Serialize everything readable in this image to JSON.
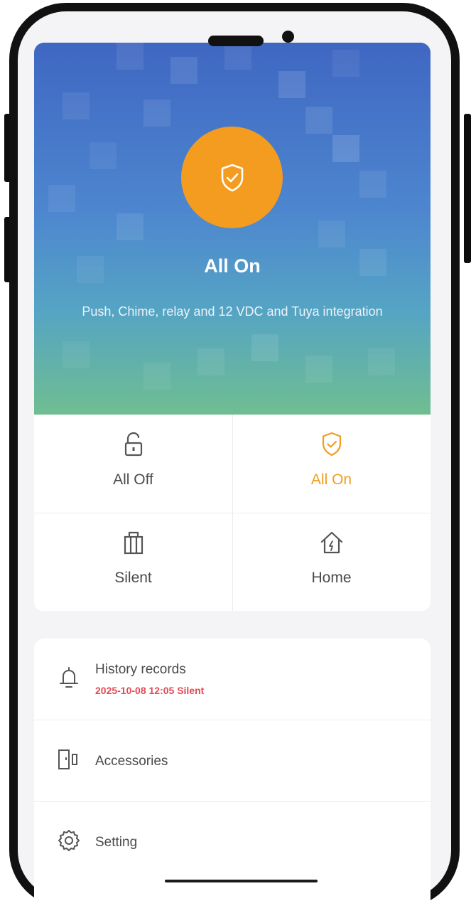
{
  "hero": {
    "title": "All On",
    "description": "Push, Chime, relay and 12 VDC and Tuya integration",
    "icon": "shield-check-icon",
    "accent_color": "#f39c1f"
  },
  "modes": [
    {
      "label": "All Off",
      "icon": "unlocked-padlock-icon",
      "active": false
    },
    {
      "label": "All On",
      "icon": "shield-check-icon",
      "active": true
    },
    {
      "label": "Silent",
      "icon": "building-icon",
      "active": false
    },
    {
      "label": "Home",
      "icon": "home-icon",
      "active": false
    }
  ],
  "menu": {
    "history": {
      "title": "History records",
      "latest": "2025-10-08 12:05 Silent",
      "icon": "bell-icon"
    },
    "accessories": {
      "title": "Accessories",
      "icon": "door-sensor-icon"
    },
    "setting": {
      "title": "Setting",
      "icon": "gear-icon"
    }
  }
}
